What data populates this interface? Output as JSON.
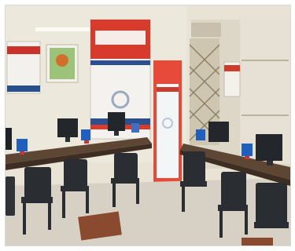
{
  "scene": {
    "banner_brand_line_1": "",
    "banner_brand_line_2": ""
  }
}
